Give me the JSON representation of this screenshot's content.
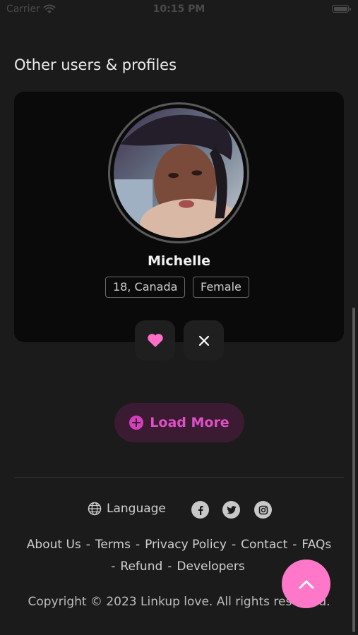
{
  "status_bar": {
    "carrier": "Carrier",
    "time": "10:15 PM"
  },
  "section": {
    "title": "Other users & profiles"
  },
  "profile": {
    "name": "Michelle",
    "age_location": "18, Canada",
    "gender": "Female",
    "avatar_icon": "user-photo"
  },
  "actions": {
    "like_icon": "heart-icon",
    "dismiss_icon": "close-icon"
  },
  "load_more": {
    "label": "Load More",
    "icon": "plus-circle-icon"
  },
  "footer": {
    "language_label": "Language",
    "social": [
      "facebook-icon",
      "twitter-icon",
      "instagram-icon"
    ],
    "links_row1": [
      "About Us",
      "Terms",
      "Privacy Policy",
      "Contact",
      "FAQs"
    ],
    "links_row2": [
      "Refund",
      "Developers"
    ],
    "separator": "-",
    "copyright": "Copyright © 2023 Linkup love. All rights reserved."
  },
  "colors": {
    "accent": "#e04fc6",
    "fab": "#ff77c9",
    "background": "#1b1b1b",
    "card": "#0a0a0a"
  }
}
